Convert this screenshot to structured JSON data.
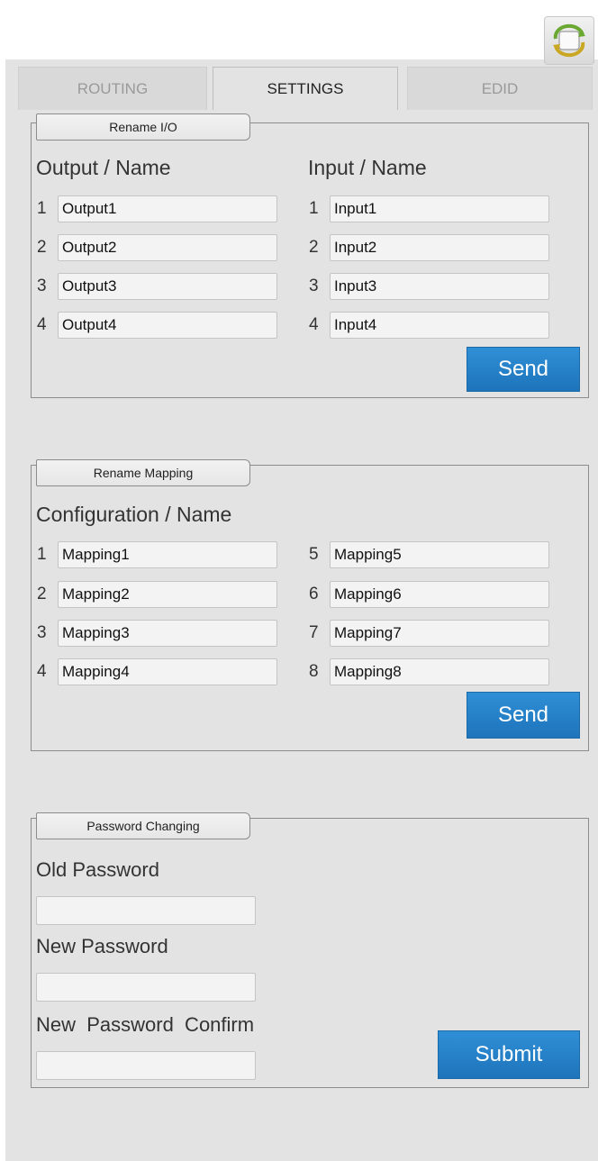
{
  "tabs": [
    {
      "label": "ROUTING"
    },
    {
      "label": "SETTINGS"
    },
    {
      "label": "EDID"
    }
  ],
  "active_tab": "SETTINGS",
  "rename_io": {
    "legend": "Rename I/O",
    "output_heading": "Output / Name",
    "input_heading": "Input / Name",
    "outputs": [
      {
        "num": "1",
        "value": "Output1"
      },
      {
        "num": "2",
        "value": "Output2"
      },
      {
        "num": "3",
        "value": "Output3"
      },
      {
        "num": "4",
        "value": "Output4"
      }
    ],
    "inputs": [
      {
        "num": "1",
        "value": "Input1"
      },
      {
        "num": "2",
        "value": "Input2"
      },
      {
        "num": "3",
        "value": "Input3"
      },
      {
        "num": "4",
        "value": "Input4"
      }
    ],
    "send_label": "Send"
  },
  "rename_mapping": {
    "legend": "Rename Mapping",
    "heading": "Configuration / Name",
    "left": [
      {
        "num": "1",
        "value": "Mapping1"
      },
      {
        "num": "2",
        "value": "Mapping2"
      },
      {
        "num": "3",
        "value": "Mapping3"
      },
      {
        "num": "4",
        "value": "Mapping4"
      }
    ],
    "right": [
      {
        "num": "5",
        "value": "Mapping5"
      },
      {
        "num": "6",
        "value": "Mapping6"
      },
      {
        "num": "7",
        "value": "Mapping7"
      },
      {
        "num": "8",
        "value": "Mapping8"
      }
    ],
    "send_label": "Send"
  },
  "password": {
    "legend": "Password Changing",
    "old_label": "Old Password",
    "new_label": "New Password",
    "confirm_label": "New  Password  Confirm",
    "old_value": "",
    "new_value": "",
    "confirm_value": "",
    "submit_label": "Submit"
  },
  "icons": {
    "refresh": "refresh-icon"
  },
  "colors": {
    "button": "#2380c8",
    "panel": "#e3e3e3",
    "border": "#8c8c8c"
  }
}
